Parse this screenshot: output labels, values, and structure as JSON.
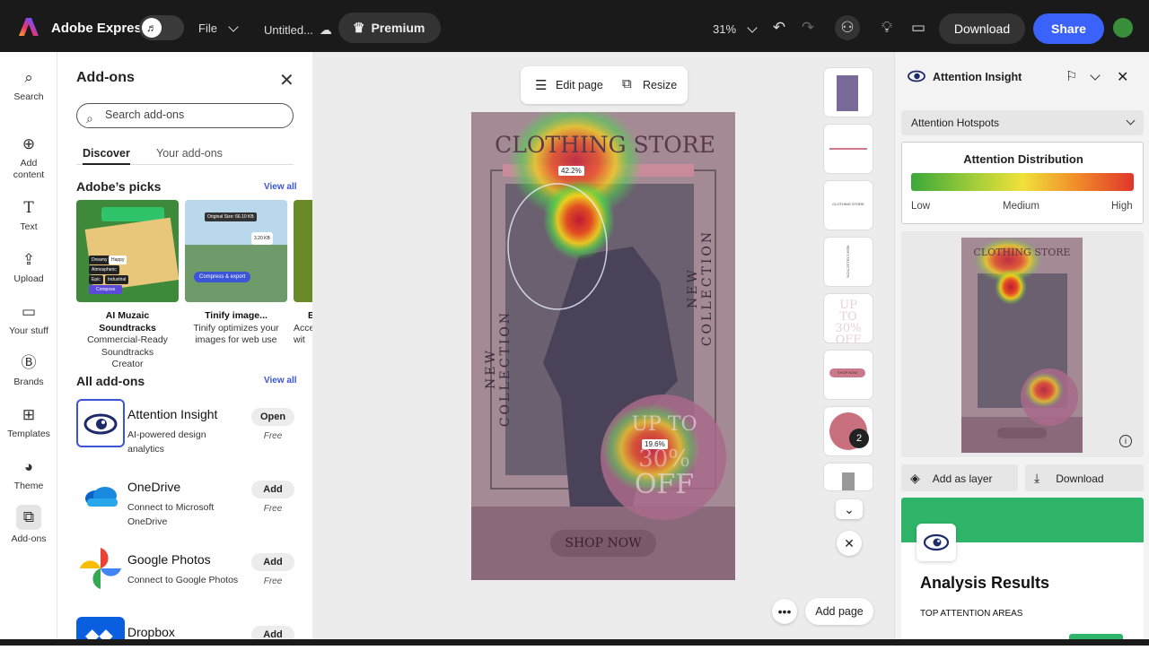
{
  "topbar": {
    "app_name": "Adobe Express",
    "file_label": "File",
    "doc_title": "Untitled...",
    "premium_label": "Premium",
    "zoom": "31%",
    "download_label": "Download",
    "share_label": "Share"
  },
  "nav": [
    {
      "label": "Search",
      "icon": "search-icon"
    },
    {
      "label": "Add content",
      "icon": "plus-circle-icon"
    },
    {
      "label": "Text",
      "icon": "text-icon"
    },
    {
      "label": "Upload",
      "icon": "upload-icon"
    },
    {
      "label": "Your stuff",
      "icon": "folder-icon"
    },
    {
      "label": "Brands",
      "icon": "brand-icon"
    },
    {
      "label": "Templates",
      "icon": "templates-icon"
    },
    {
      "label": "Theme",
      "icon": "palette-icon"
    },
    {
      "label": "Add-ons",
      "icon": "addons-icon"
    }
  ],
  "addons": {
    "title": "Add-ons",
    "search_placeholder": "Search add-ons",
    "tabs": [
      "Discover",
      "Your add-ons"
    ],
    "picks_title": "Adobe’s picks",
    "view_all": "View all",
    "picks": [
      {
        "name": "AI Muzaic Soundtracks",
        "desc": "Commercial-Ready Soundtracks Creator",
        "tile_lines": [
          "Dreamy",
          "Happy",
          "Atmospheric",
          "Epic",
          "Industrial",
          "Compose"
        ]
      },
      {
        "name": "Tinify image...",
        "desc": "Tinify optimizes your images for web use",
        "tile_lines": [
          "Original Size: 66.10 KB",
          "3.20 KB",
          "Compress & export"
        ]
      },
      {
        "name": "B",
        "desc": "Acce wit"
      }
    ],
    "all_title": "All add-ons",
    "list": [
      {
        "name": "Attention Insight",
        "desc": "AI-powered design analytics",
        "button": "Open",
        "price": "Free"
      },
      {
        "name": "OneDrive",
        "desc": "Connect to Microsoft OneDrive",
        "button": "Add",
        "price": "Free"
      },
      {
        "name": "Google Photos",
        "desc": "Connect to Google Photos",
        "button": "Add",
        "price": "Free"
      },
      {
        "name": "Dropbox",
        "desc": "",
        "button": "Add",
        "price": ""
      }
    ]
  },
  "canvas": {
    "edit_page": "Edit page",
    "resize": "Resize",
    "poster_title": "CLOTHING STORE",
    "side_text": "NEW COLLECTION",
    "promo_lines": [
      "UP TO",
      "30%",
      "OFF"
    ],
    "cta": "SHOP NOW",
    "hotspot_1": "42.2%",
    "hotspot_2": "19.6%",
    "page_badge": "2",
    "add_page": "Add page",
    "thumb_labels": [
      "CLOTHING STORE",
      "NEW COLLECTION",
      "UP TO 30% OFF",
      "SHOP NOW"
    ]
  },
  "right_panel": {
    "title": "Attention Insight",
    "dropdown": "Attention Hotspots",
    "dist_title": "Attention Distribution",
    "low": "Low",
    "medium": "Medium",
    "high": "High",
    "preview_title": "CLOTHING STORE",
    "add_layer": "Add as layer",
    "download": "Download",
    "results_title": "Analysis Results",
    "results_sub": "TOP ATTENTION AREAS"
  },
  "colors": {
    "share": "#3b63fb",
    "topbar": "#1a1a1a",
    "results_band": "#2fb56a",
    "poster": "#a48a95"
  }
}
